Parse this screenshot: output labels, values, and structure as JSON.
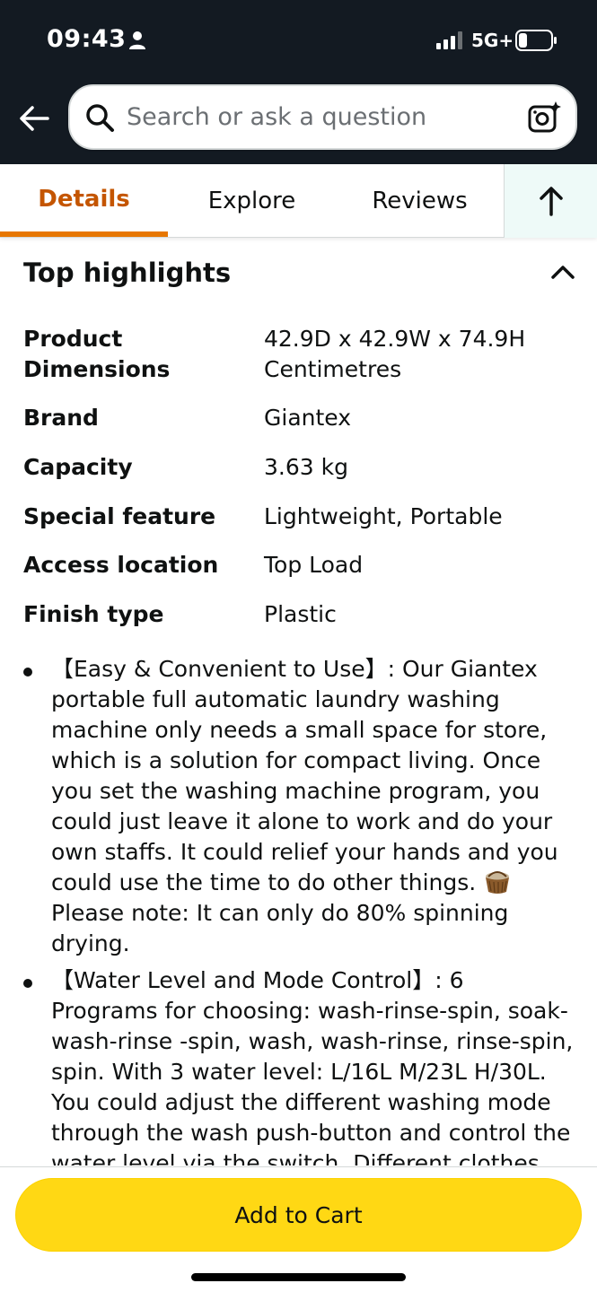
{
  "status_bar": {
    "time": "09:43",
    "network": "5G+"
  },
  "search": {
    "placeholder": "Search or ask a question"
  },
  "tabs": [
    {
      "label": "Details",
      "active": true
    },
    {
      "label": "Explore"
    },
    {
      "label": "Reviews"
    }
  ],
  "highlights": {
    "title": "Top highlights",
    "specs": [
      {
        "label": "Product Dimensions",
        "label_line1": "Product",
        "label_line2": "Dimensions",
        "value_line1": "42.9D x 42.9W x 74.9H",
        "value_line2": "Centimetres"
      },
      {
        "label": "Brand",
        "value": "Giantex"
      },
      {
        "label": "Capacity",
        "value": "3.63 kg"
      },
      {
        "label": "Special feature",
        "value": "Lightweight, Portable"
      },
      {
        "label": "Access location",
        "value": "Top Load"
      },
      {
        "label": "Finish type",
        "value": "Plastic"
      }
    ]
  },
  "bullets": [
    {
      "text_before_icon": "【Easy & Convenient to Use】: Our Giantex portable full automatic laundry washing machine only needs a small space for store, which is a solution for compact living. Once you set the washing machine program, you could just leave it alone to work and do your own staffs. It could relief your hands and you could use the time to do other things.",
      "text_after_icon": "Please note: It can only do 80% spinning drying."
    },
    {
      "text": "【Water Level and Mode Control】: 6 Programs for choosing: wash-rinse-spin, soak-wash-rinse -spin, wash, wash-rinse, rinse-spin, spin. With 3 water level: L/16L M/23L H/30L. You could adjust the different washing mode through the wash push-button and control the water level via the switch. Different clothes"
    }
  ],
  "cart": {
    "label": "Add to Cart"
  },
  "colors": {
    "header_bg": "#131a22",
    "tab_active": "#c45500",
    "tab_underline": "#e77600",
    "cart_button": "#ffd814"
  }
}
